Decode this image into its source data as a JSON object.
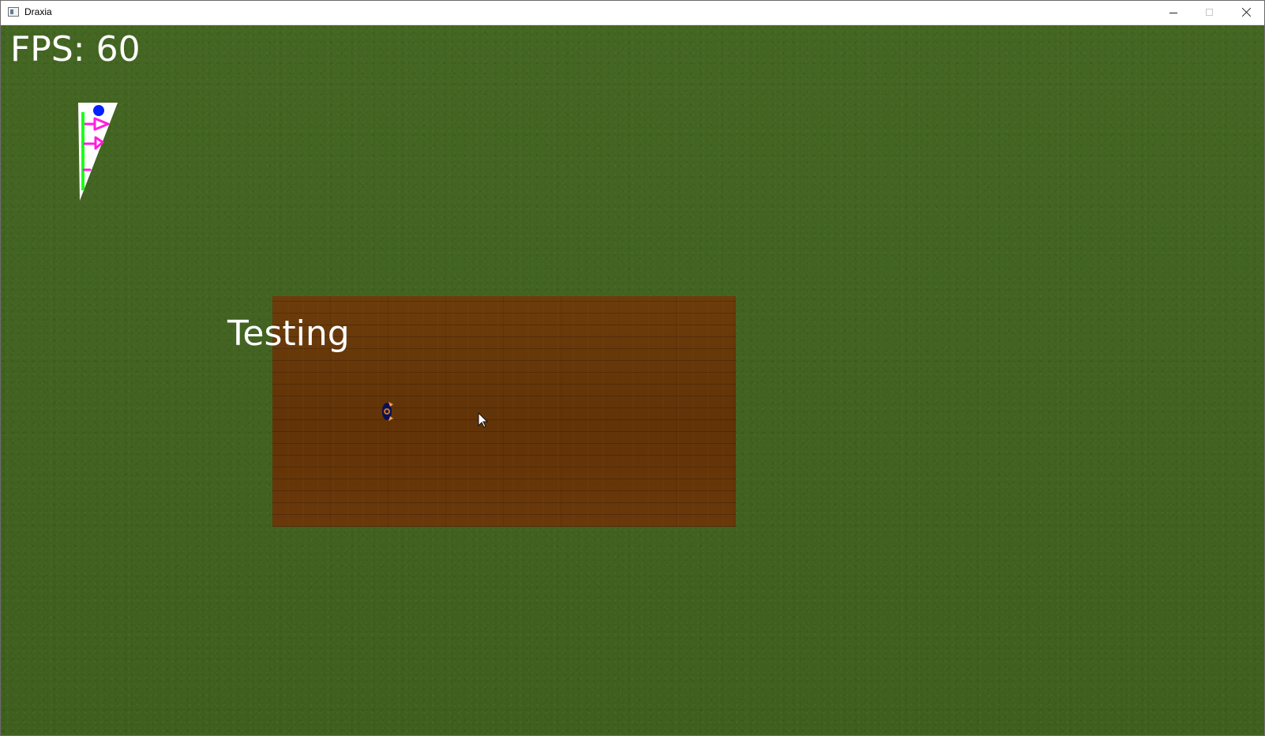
{
  "window": {
    "title": "Draxia",
    "controls": {
      "minimize_icon": "minimize-icon",
      "maximize_icon": "maximize-icon",
      "close_icon": "close-icon"
    }
  },
  "game": {
    "fps_text": "FPS: 60",
    "area_label": "Testing",
    "hud_icons": [
      "blue-dot-icon",
      "magenta-arrow-icon",
      "magenta-arrow-icon",
      "green-bar-icon"
    ],
    "player_icon": "player-icon",
    "cursor_icon": "mouse-cursor-icon"
  },
  "colors": {
    "grass": "#426322",
    "wood": "#673709",
    "hud_panel": "#ffffff",
    "hud_blue": "#0022ff",
    "hud_magenta": "#ff1edf",
    "hud_green": "#19ff19",
    "text": "#ffffff"
  }
}
